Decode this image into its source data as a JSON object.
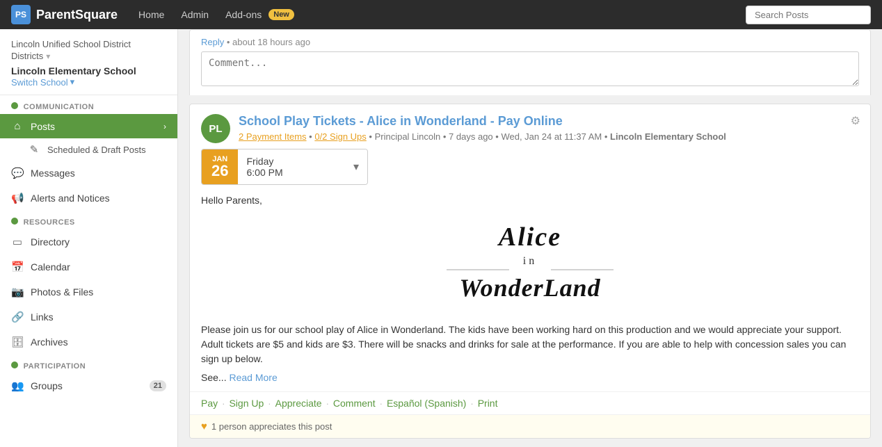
{
  "topnav": {
    "logo_text": "ParentSquare",
    "logo_icon": "PS",
    "links": [
      {
        "label": "Home",
        "name": "home-link"
      },
      {
        "label": "Admin",
        "name": "admin-link"
      },
      {
        "label": "Add-ons",
        "name": "addons-link"
      }
    ],
    "badge": "New",
    "search_placeholder": "Search Posts"
  },
  "sidebar": {
    "district": "Lincoln Unified School District",
    "districts_label": "Districts",
    "school_name": "Lincoln Elementary School",
    "switch_school": "Switch School",
    "sections": [
      {
        "label": "COMMUNICATION",
        "items": [
          {
            "icon": "🏠",
            "label": "Posts",
            "active": true,
            "arrow": true
          },
          {
            "icon": "✎",
            "label": "Scheduled & Draft Posts",
            "sub": true
          },
          {
            "icon": "💬",
            "label": "Messages"
          },
          {
            "icon": "📢",
            "label": "Alerts and Notices"
          }
        ]
      },
      {
        "label": "RESOURCES",
        "items": [
          {
            "icon": "📁",
            "label": "Directory"
          },
          {
            "icon": "📅",
            "label": "Calendar"
          },
          {
            "icon": "📷",
            "label": "Photos & Files"
          },
          {
            "icon": "🔗",
            "label": "Links"
          },
          {
            "icon": "🗄",
            "label": "Archives"
          }
        ]
      },
      {
        "label": "PARTICIPATION",
        "items": [
          {
            "icon": "👥",
            "label": "Groups",
            "count": "21"
          }
        ]
      }
    ]
  },
  "comment_area": {
    "reply_text": "Reply",
    "time_text": "about 18 hours ago",
    "comment_placeholder": "Comment..."
  },
  "post": {
    "avatar_initials": "PL",
    "title": "School Play Tickets - Alice in Wonderland - Pay Online",
    "payment_items": "2 Payment Items",
    "signup": "0/2 Sign Ups",
    "author": "Principal Lincoln",
    "time_ago": "7 days ago",
    "date_full": "Wed, Jan 24 at 11:37 AM",
    "school": "Lincoln Elementary School",
    "date_month": "JAN",
    "date_day": "26",
    "date_weekday": "Friday",
    "date_time": "6:00 PM",
    "greeting": "Hello Parents,",
    "description_part1": "Please join us for our school play of Alice in Wonderland. The kids have been working hard on this production and we would appreciate your support. Adult tickets are $5 and kids are $3. There will be snacks and drinks for sale at the performance. If you are able to help with concession sales you can sign up below.",
    "see_more": "See...",
    "read_more": "Read More",
    "actions": [
      "Pay",
      "Sign Up",
      "Appreciate",
      "Comment",
      "Español (Spanish)",
      "Print"
    ],
    "appreciation": "1 person appreciates this post"
  }
}
